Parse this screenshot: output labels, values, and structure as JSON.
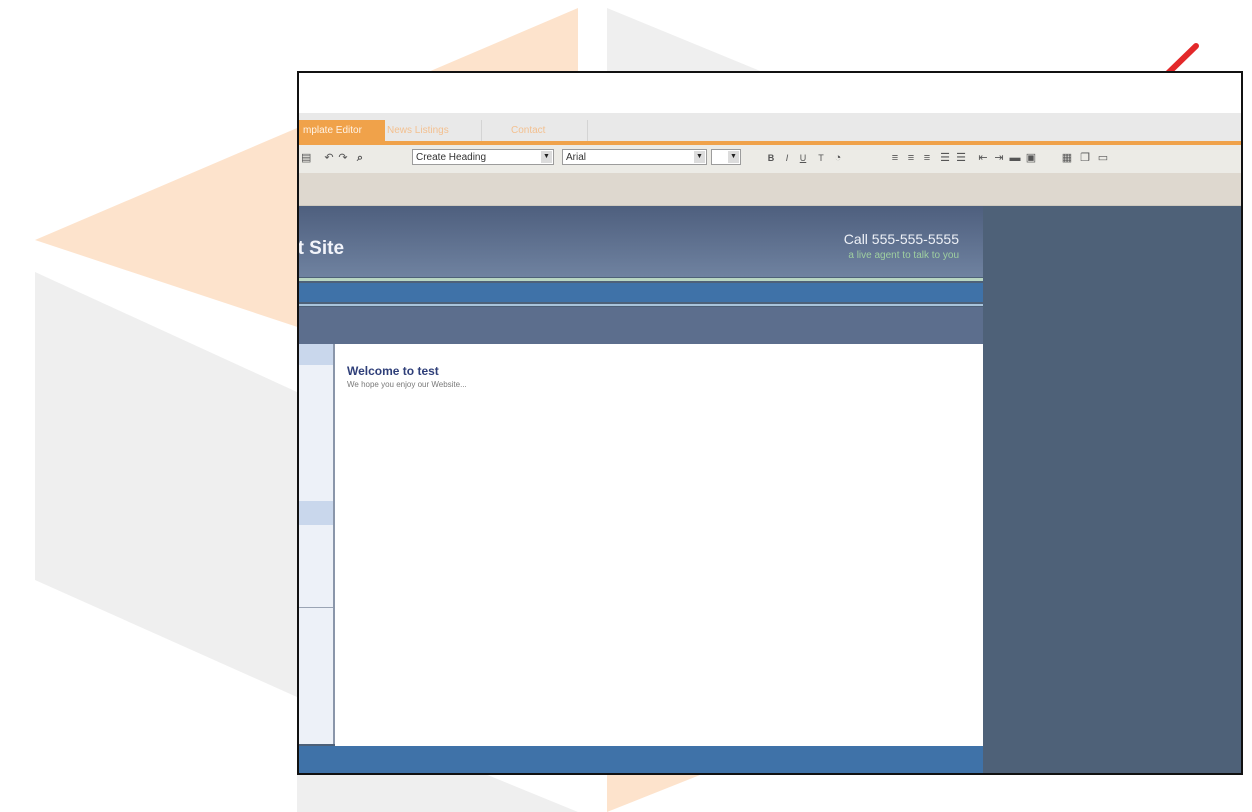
{
  "tabs": [
    {
      "label": "mplate Editor",
      "active": true
    },
    {
      "label": "News Listings",
      "active": false
    },
    {
      "label": "Contact",
      "active": false
    }
  ],
  "toolbar": {
    "heading_select": "Create Heading",
    "font_select": "Arial",
    "size_select": "",
    "icons": [
      "paste-icon",
      "undo-icon",
      "redo-icon",
      "find-icon",
      "bold-icon",
      "italic-icon",
      "underline-icon",
      "text-color-icon",
      "highlight-icon",
      "align-left-icon",
      "align-center-icon",
      "align-right-icon",
      "ordered-list-icon",
      "unordered-list-icon",
      "outdent-icon",
      "indent-icon",
      "horizontal-rule-icon",
      "insert-box-icon",
      "table-icon",
      "popout-icon",
      "window-icon"
    ]
  },
  "site": {
    "title": "st Site",
    "phone": "Call 555-555-5555",
    "tagline": "a live agent to talk to you"
  },
  "content": {
    "heading": "Welcome to test",
    "body": "We hope you enjoy our Website..."
  },
  "colors": {
    "accent_orange": "#f0a24a",
    "header_blue": "#4e5f7e",
    "nav_blue": "#3f72a8",
    "frame_slate": "#4e6178",
    "arrow_red": "#e3282a"
  }
}
